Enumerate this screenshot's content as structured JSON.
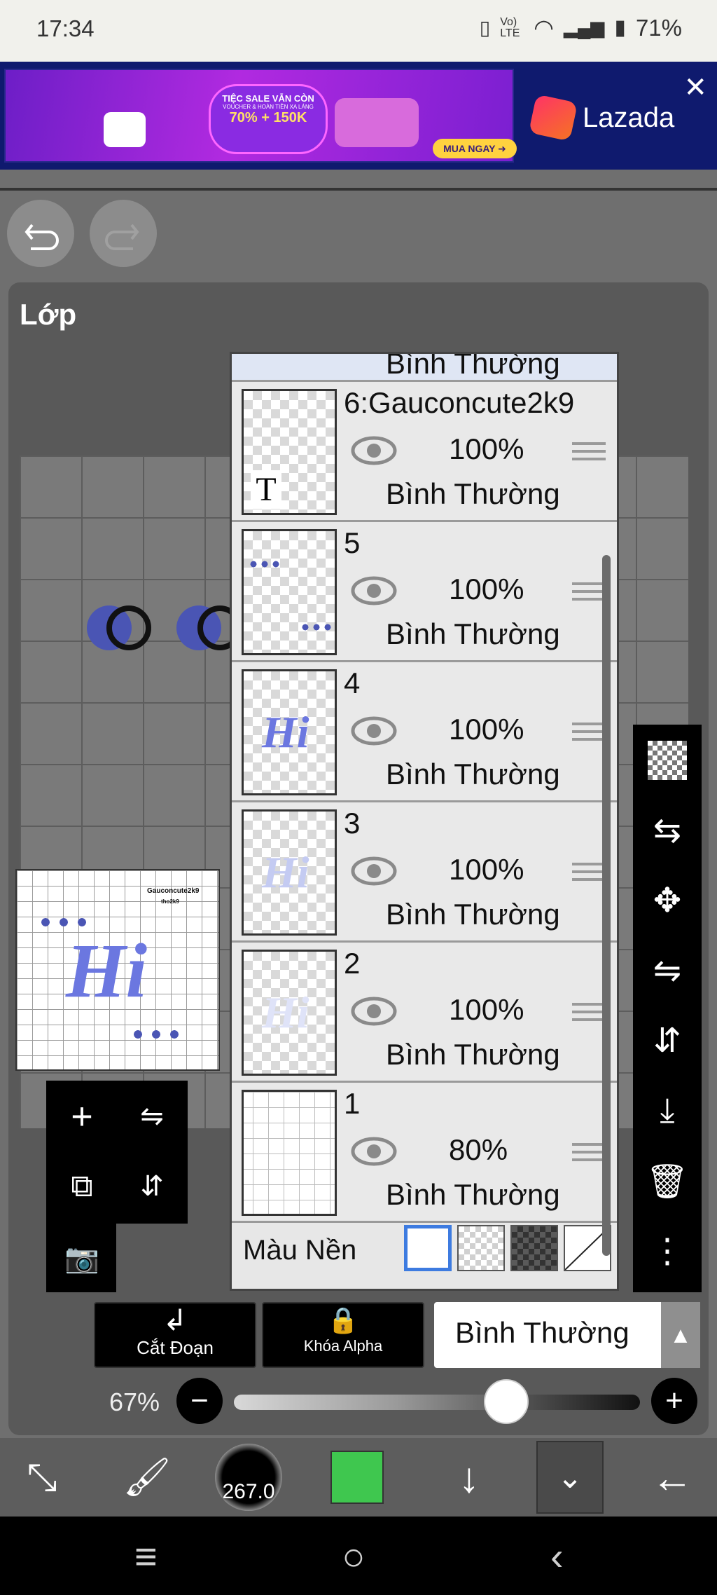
{
  "status_bar": {
    "time": "17:34",
    "network": "Vo) LTE",
    "battery": "71%"
  },
  "ad": {
    "brand": "Lazada",
    "banner_headline": "TIỆC SALE VẪN CÒN",
    "banner_sub": "VOUCHER & HOÀN TIỀN XA LÁNG",
    "voucher_1": "70%",
    "voucher_2": "150K",
    "cta": "MUA NGAY",
    "close_symbol": "✕"
  },
  "panel": {
    "title": "Lớp"
  },
  "layers": [
    {
      "name": "6:Gauconcute2k9",
      "opacity": "100%",
      "blend": "Bình Thường",
      "thumb_letter": "T"
    },
    {
      "name": "5",
      "opacity": "100%",
      "blend": "Bình Thường"
    },
    {
      "name": "4",
      "opacity": "100%",
      "blend": "Bình Thường",
      "thumb_text": "Hi"
    },
    {
      "name": "3",
      "opacity": "100%",
      "blend": "Bình Thường",
      "thumb_text": "Hi"
    },
    {
      "name": "2",
      "opacity": "100%",
      "blend": "Bình Thường",
      "thumb_text": "Hi"
    },
    {
      "name": "1",
      "opacity": "80%",
      "blend": "Bình Thường"
    }
  ],
  "partial_layer_blend": "Bình Thường",
  "background": {
    "label": "Màu Nền"
  },
  "preview": {
    "caption_1": "Gauconcute2k9",
    "caption_2": "tho2k9",
    "text": "Hi"
  },
  "actions": {
    "clipping": "Cắt Đoạn",
    "alpha_lock": "Khóa Alpha",
    "blend_mode": "Bình Thường"
  },
  "zoom": {
    "percent": "67%",
    "level": 0.67
  },
  "brush_size": "267.0",
  "colors": {
    "current": "#3fc74f",
    "accent": "#4a55b4",
    "lazada": "#f57224"
  }
}
